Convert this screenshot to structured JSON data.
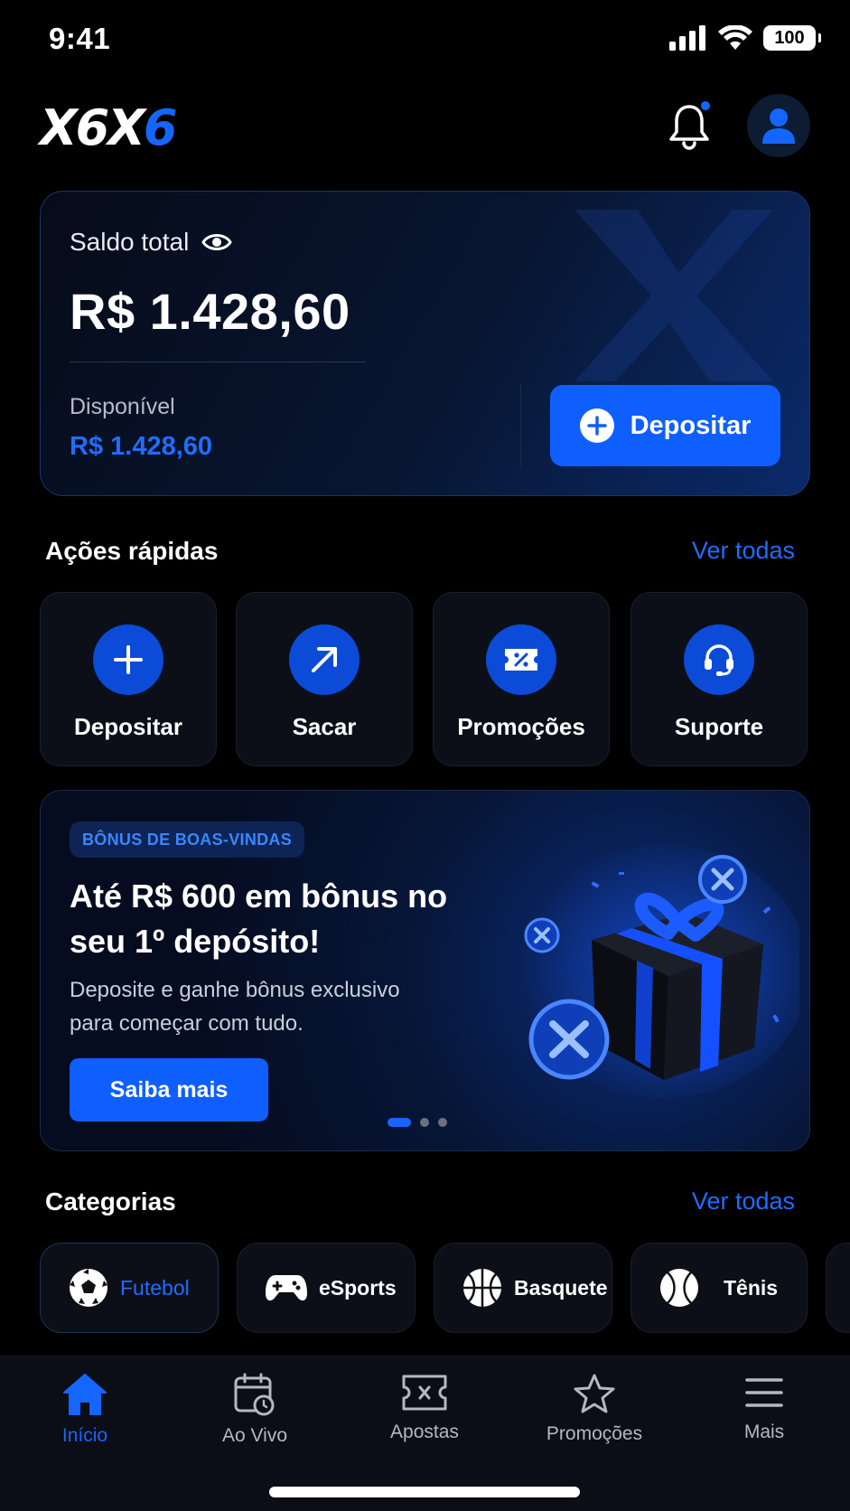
{
  "status_bar": {
    "time": "9:41",
    "battery": "100"
  },
  "header": {
    "logo_white": "X6X",
    "logo_blue": "6"
  },
  "balance": {
    "label": "Saldo total",
    "total": "R$ 1.428,60",
    "available_label": "Disponível",
    "available_value": "R$ 1.428,60",
    "deposit_label": "Depositar"
  },
  "quick_actions": {
    "title": "Ações rápidas",
    "see_all": "Ver todas",
    "items": [
      {
        "label": "Depositar",
        "icon": "plus-icon"
      },
      {
        "label": "Sacar",
        "icon": "arrow-up-right-icon"
      },
      {
        "label": "Promoções",
        "icon": "coupon-icon"
      },
      {
        "label": "Suporte",
        "icon": "headset-icon"
      }
    ]
  },
  "promo": {
    "badge": "BÔNUS DE BOAS-VINDAS",
    "title": "Até R$ 600 em bônus no seu 1º depósito!",
    "description": "Deposite e ganhe bônus exclusivo para começar com tudo.",
    "cta": "Saiba mais",
    "slide_count": 3,
    "active_slide": 1
  },
  "categories": {
    "title": "Categorias",
    "see_all": "Ver todas",
    "items": [
      {
        "label": "Futebol",
        "icon": "soccer-ball-icon",
        "active": true
      },
      {
        "label": "eSports",
        "icon": "gamepad-icon"
      },
      {
        "label": "Basquete",
        "icon": "basketball-icon"
      },
      {
        "label": "Tênis",
        "icon": "tennis-ball-icon"
      }
    ]
  },
  "tabbar": {
    "items": [
      {
        "label": "Início",
        "icon": "home-icon",
        "active": true
      },
      {
        "label": "Ao Vivo",
        "icon": "calendar-clock-icon"
      },
      {
        "label": "Apostas",
        "icon": "ticket-icon"
      },
      {
        "label": "Promoções",
        "icon": "star-icon"
      },
      {
        "label": "Mais",
        "icon": "menu-icon"
      }
    ]
  },
  "colors": {
    "accent": "#1466ff",
    "background": "#000000",
    "card": "#0c0f17"
  }
}
